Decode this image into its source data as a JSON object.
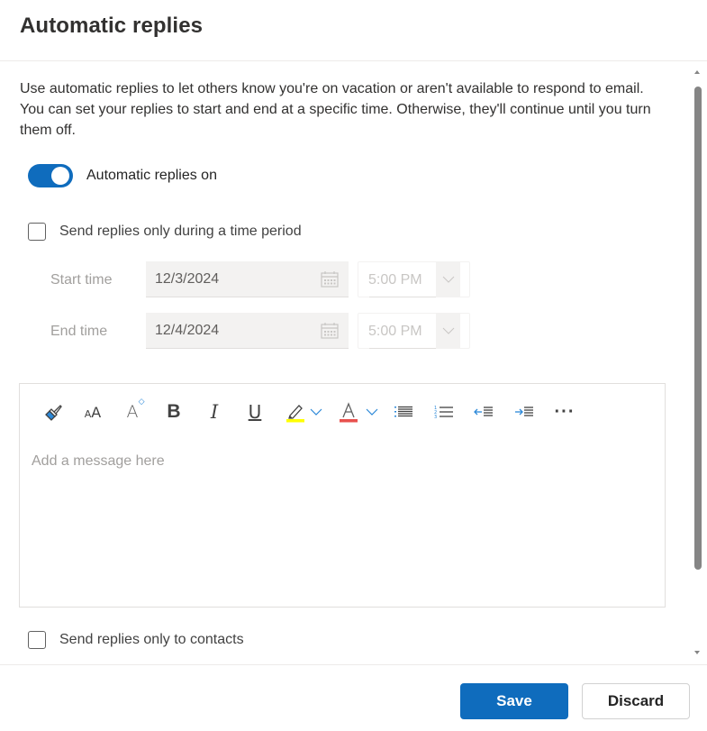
{
  "header": {
    "title": "Automatic replies"
  },
  "description": "Use automatic replies to let others know you're on vacation or aren't available to respond to email. You can set your replies to start and end at a specific time. Otherwise, they'll continue until you turn them off.",
  "auto_reply_toggle": {
    "label": "Automatic replies on",
    "on": true,
    "color": "#0f6cbd"
  },
  "time_period_checkbox": {
    "label": "Send replies only during a time period",
    "checked": false
  },
  "start": {
    "label": "Start time",
    "date": "12/3/2024",
    "time": "5:00 PM",
    "icon": "calendar-icon"
  },
  "end": {
    "label": "End time",
    "date": "12/4/2024",
    "time": "5:00 PM",
    "icon": "calendar-icon"
  },
  "editor": {
    "placeholder": "Add a message here",
    "toolbar": [
      {
        "name": "format-painter",
        "icon": "paintbrush-icon"
      },
      {
        "name": "font-size",
        "icon": "font-size-icon",
        "glyph": "AA"
      },
      {
        "name": "grow-font",
        "icon": "grow-font-icon",
        "glyph": "A"
      },
      {
        "name": "bold",
        "icon": "bold-icon",
        "glyph": "B"
      },
      {
        "name": "italic",
        "icon": "italic-icon",
        "glyph": "I"
      },
      {
        "name": "underline",
        "icon": "underline-icon",
        "glyph": "U"
      },
      {
        "name": "highlight",
        "icon": "highlighter-icon",
        "color": "#ffff00"
      },
      {
        "name": "font-color",
        "icon": "font-color-icon",
        "glyph": "A",
        "color": "#e8514e"
      },
      {
        "name": "bullets",
        "icon": "bullet-list-icon"
      },
      {
        "name": "numbering",
        "icon": "numbered-list-icon"
      },
      {
        "name": "decrease-indent",
        "icon": "decrease-indent-icon"
      },
      {
        "name": "increase-indent",
        "icon": "increase-indent-icon"
      },
      {
        "name": "more",
        "icon": "more-icon",
        "glyph": "···"
      }
    ]
  },
  "contacts_checkbox": {
    "label": "Send replies only to contacts",
    "checked": false
  },
  "footer": {
    "save_label": "Save",
    "discard_label": "Discard",
    "accent": "#0f6cbd"
  }
}
